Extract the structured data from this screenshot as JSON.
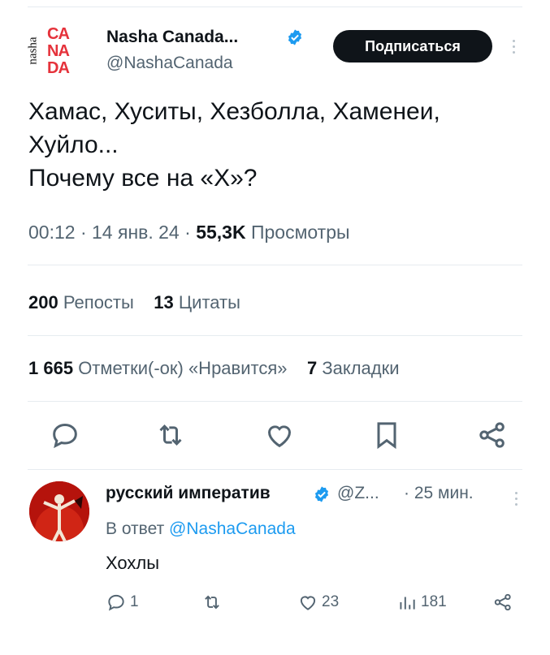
{
  "author": {
    "logo_side": "nasha",
    "logo_letters": [
      "CA",
      "NA",
      "DA"
    ],
    "name": "Nasha Canada...",
    "handle": "@NashaCanada",
    "subscribe_label": "Подписаться"
  },
  "tweet": {
    "lines": [
      "Хамас, Хуситы, Хезболла, Хаменеи,",
      "Хуйло...",
      "Почему все на «Х»?"
    ],
    "time": "00:12",
    "date": "14 янв. 24",
    "views_count": "55,3K",
    "views_label": "Просмотры"
  },
  "stats": {
    "reposts_count": "200",
    "reposts_label": "Репосты",
    "quotes_count": "13",
    "quotes_label": "Цитаты",
    "likes_count": "1 665",
    "likes_label": "Отметки(-ок) «Нравится»",
    "bookmarks_count": "7",
    "bookmarks_label": "Закладки"
  },
  "actions": [
    "reply-icon",
    "repost-icon",
    "like-icon",
    "bookmark-icon",
    "share-icon"
  ],
  "reply": {
    "name": "русский императив",
    "handle": "@Z...",
    "time": "· 25 мин.",
    "reply_to_prefix": "В ответ",
    "reply_to_handle": "@NashaCanada",
    "text": "Хохлы",
    "reply_count": "1",
    "likes_count": "23",
    "views_count": "181"
  },
  "colors": {
    "accent": "#1d9bf0",
    "text": "#0f1419",
    "muted": "#536471",
    "logo_red": "#e5323b",
    "button_bg": "#0f1419"
  }
}
